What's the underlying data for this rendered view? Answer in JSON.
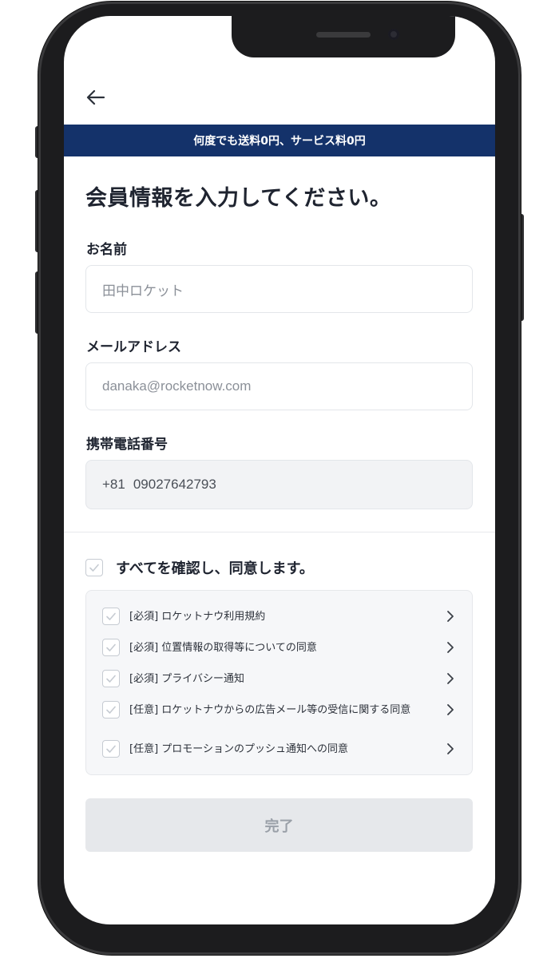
{
  "header": {
    "back_icon": "arrow-left-icon"
  },
  "banner": {
    "text": "何度でも送料0円、サービス料0円",
    "background": "#14326a"
  },
  "title": "会員情報を入力してください。",
  "fields": {
    "name": {
      "label": "お名前",
      "placeholder": "田中ロケット"
    },
    "email": {
      "label": "メールアドレス",
      "placeholder": "danaka@rocketnow.com"
    },
    "phone": {
      "label": "携帯電話番号",
      "country_code": "+81",
      "value": "09027642793"
    }
  },
  "agreement": {
    "all_label": "すべてを確認し、同意します。",
    "items": [
      {
        "label": "[必須] ロケットナウ利用規約"
      },
      {
        "label": "[必須] 位置情報の取得等についての同意"
      },
      {
        "label": "[必須] プライバシー通知"
      },
      {
        "label": "[任意] ロケットナウからの広告メール等の受信に関する同意"
      },
      {
        "label": "[任意] プロモーションのプッシュ通知への同意"
      }
    ]
  },
  "submit": {
    "label": "完了",
    "state": "disabled"
  }
}
